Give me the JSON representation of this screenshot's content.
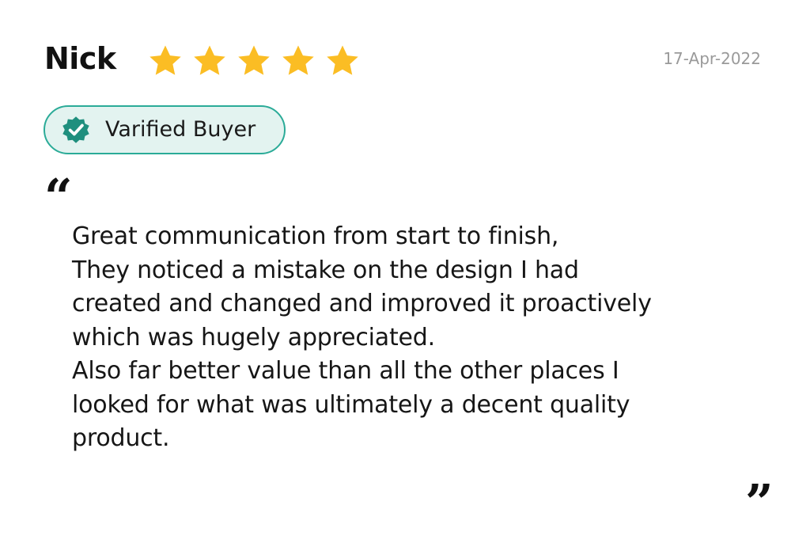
{
  "review": {
    "reviewer_name": "Nick",
    "rating": 5,
    "rating_max": 5,
    "date": "17-Apr-2022",
    "badge": {
      "label": "Varified Buyer",
      "icon": "verified-check-badge-icon"
    },
    "quote_open": "“",
    "quote_close": "”",
    "body_lines": [
      "Great communication from start to finish,",
      "They noticed a mistake on the design I had",
      "created and changed and improved it proactively",
      "which was hugely appreciated.",
      "Also far better value than all the other places I",
      "looked for what was ultimately a decent quality",
      "product."
    ]
  },
  "colors": {
    "star": "#fbbd24",
    "badge_border": "#2bab98",
    "badge_background": "#e3f3f0",
    "badge_icon": "#1f8f7e",
    "date_text": "#9a9a9a"
  }
}
